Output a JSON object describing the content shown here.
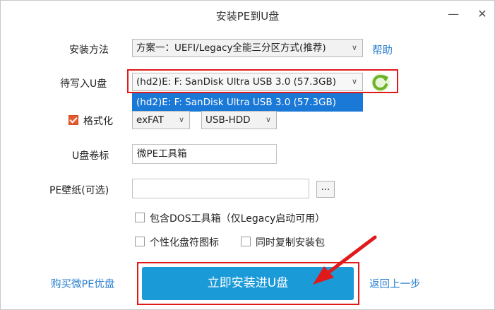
{
  "window": {
    "title": "安装PE到U盘",
    "min_symbol": "—",
    "close_symbol": "✕"
  },
  "install_method": {
    "label": "安装方法",
    "value": "方案一：UEFI/Legacy全能三分区方式(推荐)",
    "help": "帮助"
  },
  "target_disk": {
    "label": "待写入U盘",
    "value": "(hd2)E: F: SanDisk Ultra USB 3.0 (57.3GB)",
    "dropdown_option": "(hd2)E: F: SanDisk Ultra USB 3.0 (57.3GB)"
  },
  "format": {
    "label": "格式化",
    "checked": true,
    "fs_value": "exFAT",
    "mode_value": "USB-HDD"
  },
  "volume_label": {
    "label": "U盘卷标",
    "value": "微PE工具箱"
  },
  "wallpaper": {
    "label": "PE壁纸(可选)",
    "value": "",
    "browse": "..."
  },
  "options": {
    "include_dos": "包含DOS工具箱（仅Legacy启动可用）",
    "custom_icon": "个性化盘符图标",
    "copy_installer": "同时复制安装包"
  },
  "footer": {
    "buy_link": "购买微PE优盘",
    "install_button": "立即安装进U盘",
    "back_link": "返回上一步"
  },
  "colors": {
    "accent": "#1b9ad8",
    "link": "#2a7fd0",
    "highlight_red": "#e01a1a",
    "dropdown_selected": "#1a78d6",
    "refresh_green": "#6cb32a"
  }
}
